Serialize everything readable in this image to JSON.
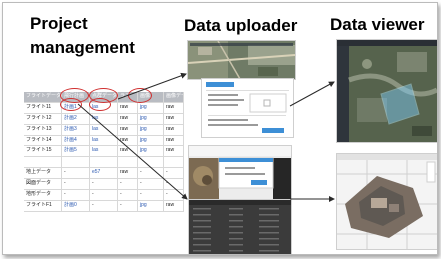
{
  "headings": {
    "project_line1": "Project",
    "project_line2": "management",
    "uploader": "Data uploader",
    "viewer": "Data viewer"
  },
  "colors": {
    "annotation_circle": "#d03030",
    "arrow": "#2a2a2a",
    "table_header": "#b9bcc2",
    "link_text": "#2b58b0"
  },
  "table": {
    "columns": [
      "フライトデータ名",
      "飛行計画",
      "点群データ",
      "ラス",
      "画像",
      "画像データ"
    ],
    "rows": [
      [
        "フライト11",
        "計画1",
        "las",
        "raw",
        "jpg",
        "raw"
      ],
      [
        "フライト12",
        "計画2",
        "las",
        "raw",
        "jpg",
        "raw"
      ],
      [
        "フライト13",
        "計画3",
        "las",
        "raw",
        "jpg",
        "raw"
      ],
      [
        "フライト14",
        "計画4",
        "las",
        "raw",
        "jpg",
        "raw"
      ],
      [
        "フライト15",
        "計画5",
        "las",
        "raw",
        "jpg",
        "raw"
      ],
      [
        "",
        "",
        "",
        "",
        "",
        ""
      ],
      [
        "地上データ",
        "-",
        "e57",
        "raw",
        "-",
        "-"
      ],
      [
        "図面データ",
        "-",
        "-",
        "-",
        "-",
        "-"
      ],
      [
        "地形データ",
        "-",
        "-",
        "-",
        "-",
        "-"
      ],
      [
        "フライトF1",
        "計画0",
        "-",
        "-",
        "jpg",
        "raw"
      ]
    ]
  }
}
